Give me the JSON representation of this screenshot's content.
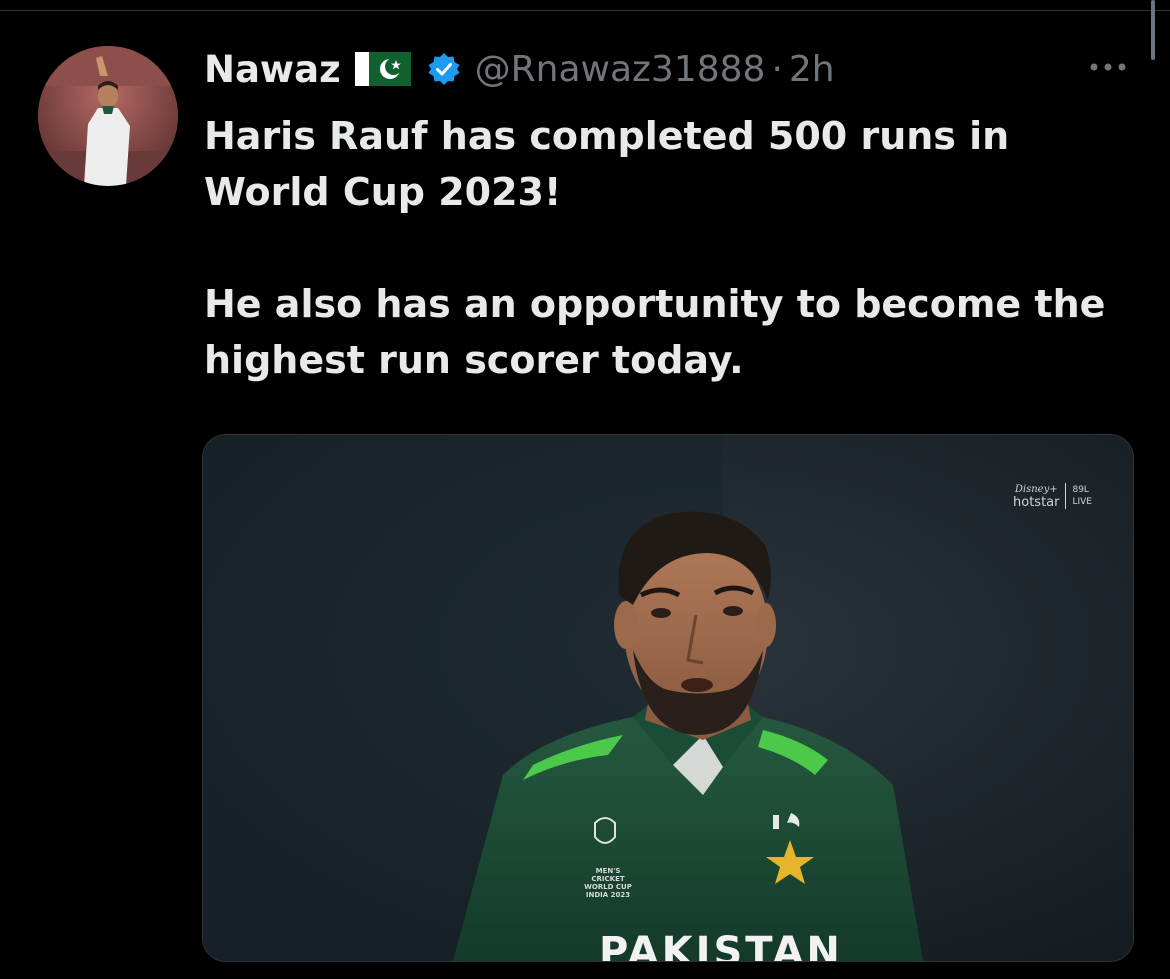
{
  "tweet": {
    "author": {
      "display_name": "Nawaz",
      "flag_icon": "pakistan-flag-icon",
      "verified_icon": "verified-badge-icon",
      "handle": "@Rnawaz31888",
      "separator": "·",
      "timestamp": "2h"
    },
    "more_icon": "more-options-icon",
    "paragraphs": [
      "Haris Rauf has completed 500 runs in World Cup 2023!",
      "He also has an opportunity to become the highest run scorer today."
    ],
    "media": {
      "watermark_disney": "Disney+",
      "watermark_hotstar": "hotstar",
      "watermark_viewers": "89L",
      "watermark_live": "LIVE",
      "jersey_text": "PAKISTAN",
      "tournament_logo_line1": "MEN'S",
      "tournament_logo_line2": "CRICKET WORLD CUP",
      "tournament_logo_line3": "INDIA 2023"
    }
  },
  "colors": {
    "background": "#000000",
    "text_primary": "#e7e9ea",
    "text_secondary": "#71767b",
    "verified_blue": "#1d9bf0",
    "jersey_green": "#1f4f3a",
    "jersey_accent": "#4cc94a"
  }
}
